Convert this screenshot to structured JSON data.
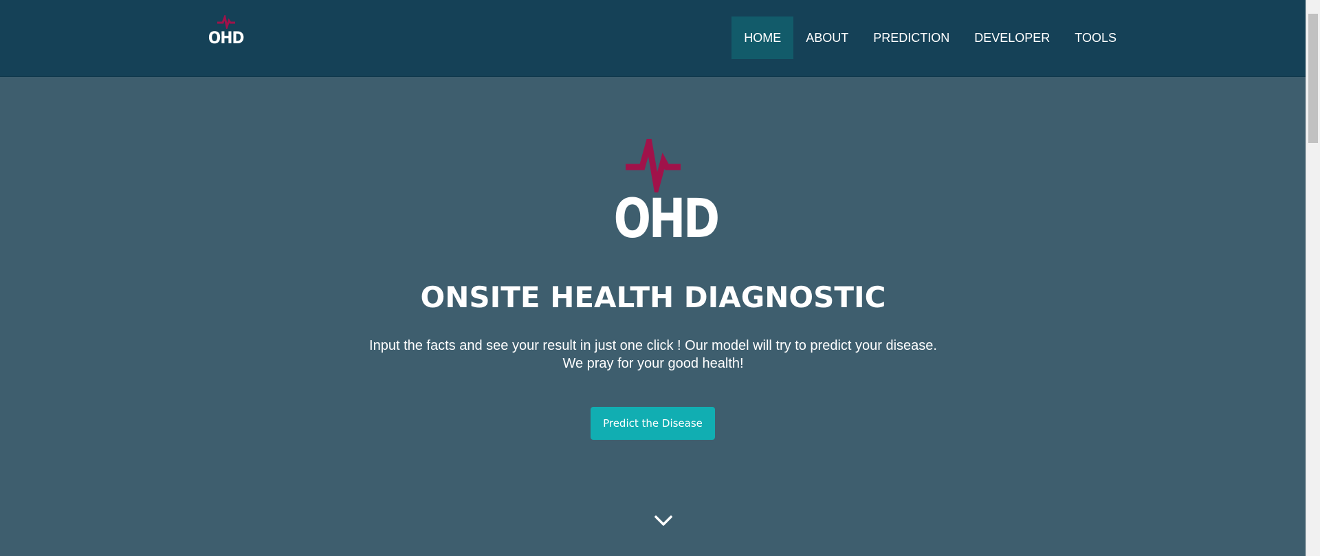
{
  "brand": {
    "logo_text": "OHD",
    "accent_color": "#a0124a"
  },
  "nav": {
    "items": [
      {
        "label": "HOME",
        "active": true
      },
      {
        "label": "ABOUT",
        "active": false
      },
      {
        "label": "PREDICTION",
        "active": false
      },
      {
        "label": "DEVELOPER",
        "active": false
      },
      {
        "label": "TOOLS",
        "active": false
      }
    ]
  },
  "hero": {
    "logo_text": "OHD",
    "title": "ONSITE HEALTH DIAGNOSTIC",
    "subtitle_line1": "Input the facts and see your result in just one click ! Our model will try to predict your disease.",
    "subtitle_line2": "We pray for your good health!",
    "cta_label": "Predict the Disease",
    "scroll_icon": "chevron-down-icon"
  },
  "colors": {
    "navbar_bg": "#154157",
    "hero_bg": "#3e5e6e",
    "nav_active_bg": "#125b6a",
    "button_bg": "#11aeb2"
  }
}
